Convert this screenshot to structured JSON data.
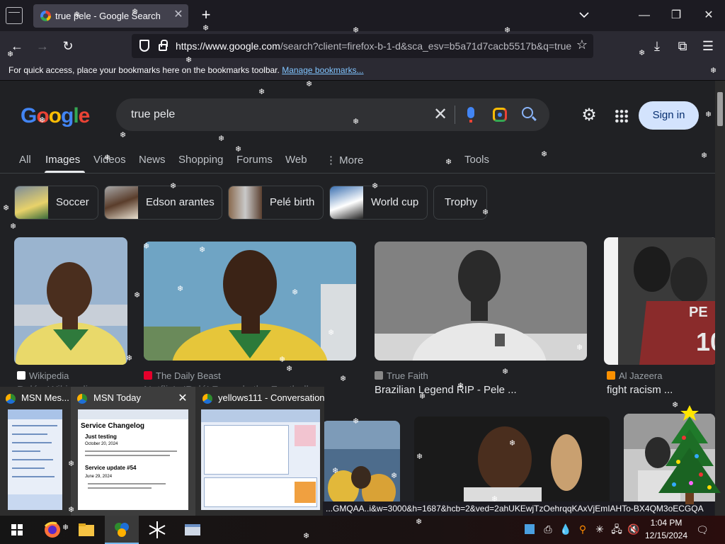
{
  "browser": {
    "tab_title": "true pele - Google Search",
    "url_host": "https://www.google.com",
    "url_rest": "/search?client=firefox-b-1-d&sca_esv=b5a71d7cacb5517b&q=true",
    "bookmarks_text": "For quick access, place your bookmarks here on the bookmarks toolbar.",
    "bookmarks_link": "Manage bookmarks..."
  },
  "google": {
    "logo_letters": [
      "G",
      "o",
      "o",
      "g",
      "l",
      "e"
    ],
    "logo_colors": [
      "#4285f4",
      "#ea4335",
      "#fbbc05",
      "#4285f4",
      "#34a853",
      "#ea4335"
    ],
    "query": "true pele",
    "signin": "Sign in",
    "tabs": [
      {
        "label": "All"
      },
      {
        "label": "Images"
      },
      {
        "label": "Videos"
      },
      {
        "label": "News"
      },
      {
        "label": "Shopping"
      },
      {
        "label": "Forums"
      },
      {
        "label": "Web"
      },
      {
        "label": "⋮ More"
      }
    ],
    "tools": "Tools",
    "chips": [
      {
        "label": "Soccer"
      },
      {
        "label": "Edson arantes"
      },
      {
        "label": "Pelé birth"
      },
      {
        "label": "World cup"
      },
      {
        "label": "Trophy"
      }
    ],
    "results": [
      {
        "source": "Wikipedia",
        "title": "Pelé - Wikipedia",
        "fav_color": "#ffffff"
      },
      {
        "source": "The Daily Beast",
        "title": "Netflix's 'Pelé' Reveals the Football",
        "fav_color": "#e4002b"
      },
      {
        "source": "True Faith",
        "title": "Brazilian Legend RIP - Pele ...",
        "fav_color": "#888888"
      },
      {
        "source": "Al Jazeera",
        "title": "fight racism ...",
        "fav_color": "#fa9000"
      }
    ]
  },
  "thumbs": [
    {
      "title": "MSN Mes..."
    },
    {
      "title": "MSN Today",
      "close": "✕",
      "doc_title": "Service Changelog",
      "doc_lines": [
        "Just testing",
        "October 20, 2024",
        "Service update #54",
        "June 29, 2024"
      ]
    },
    {
      "title": "yellows111 - Conversation"
    }
  ],
  "status_url": "...GMQAA..i&w=3000&h=1687&hcb=2&ved=2ahUKEwjTzOehrqqKAxVjEmIAHTo-BX4QM3oECGQA",
  "clock": {
    "time": "1:04 PM",
    "date": "12/15/2024"
  }
}
